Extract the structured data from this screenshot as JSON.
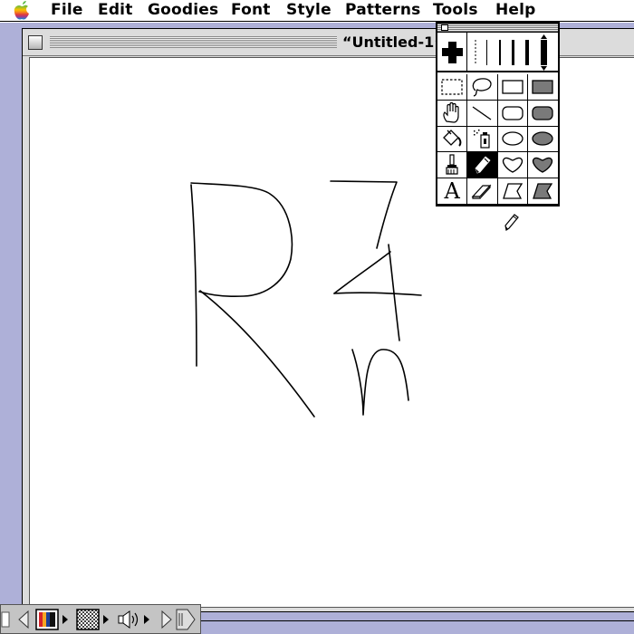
{
  "menubar": {
    "apple_icon": "rainbow-apple-icon",
    "items": [
      "File",
      "Edit",
      "Goodies",
      "Font",
      "Style",
      "Patterns",
      "Tools",
      "Help"
    ]
  },
  "window": {
    "title": "“Untitled-1”"
  },
  "palette": {
    "tools": [
      {
        "icon": "selection-rectangle-icon"
      },
      {
        "icon": "lasso-icon"
      },
      {
        "icon": "rectangle-icon"
      },
      {
        "icon": "filled-rectangle-icon"
      },
      {
        "icon": "grabber-hand-icon"
      },
      {
        "icon": "line-icon"
      },
      {
        "icon": "rounded-rectangle-icon"
      },
      {
        "icon": "filled-rounded-rectangle-icon"
      },
      {
        "icon": "paint-bucket-icon"
      },
      {
        "icon": "spray-can-icon"
      },
      {
        "icon": "oval-icon"
      },
      {
        "icon": "filled-oval-icon"
      },
      {
        "icon": "paintbrush-icon"
      },
      {
        "icon": "pencil-icon",
        "selected": true
      },
      {
        "icon": "freeform-shape-icon"
      },
      {
        "icon": "filled-freeform-shape-icon"
      },
      {
        "icon": "text-tool-icon",
        "letter": "A"
      },
      {
        "icon": "eraser-icon"
      },
      {
        "icon": "polygon-icon"
      },
      {
        "icon": "filled-polygon-icon"
      }
    ],
    "line_widths_icon": "line-width-selector-icon",
    "crosshair_icon": "crosshair-icon"
  },
  "cursor": {
    "icon": "pencil-cursor-icon"
  },
  "control_strip": {
    "icons": [
      "collapse-arrow-icon",
      "monitor-colors-icon",
      "pattern-icon",
      "speaker-volume-icon",
      "scroll-arrow-icon",
      "strip-tab-icon"
    ]
  },
  "colors": {
    "desktop": "#aeb0d8",
    "window_chrome": "#dcdcdc",
    "selected_tool": "#000000"
  }
}
